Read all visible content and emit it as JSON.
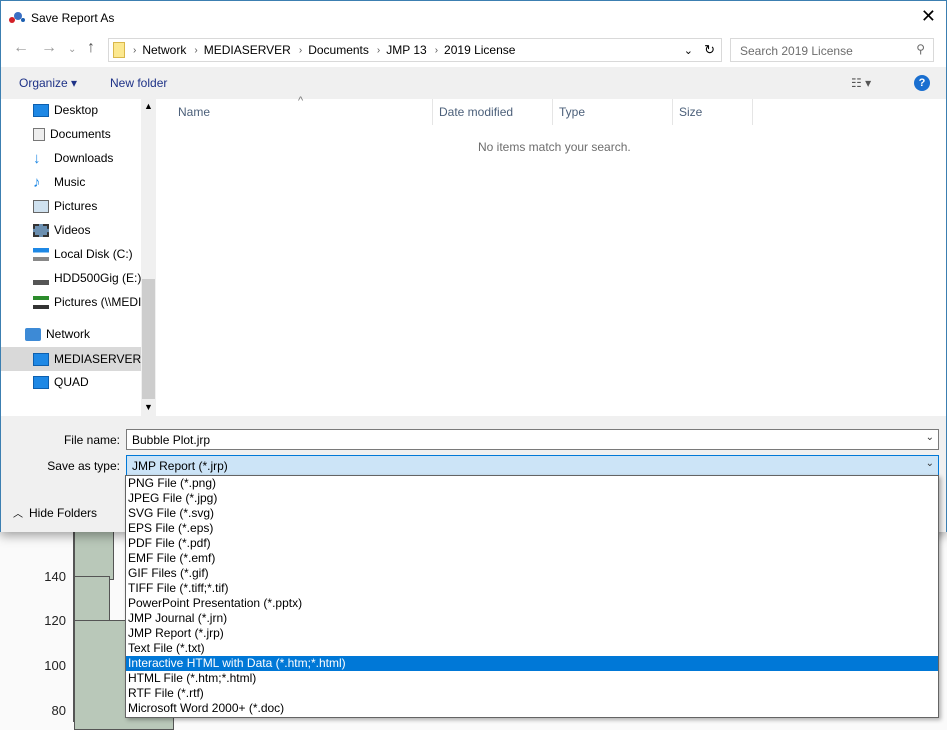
{
  "window": {
    "title": "Save Report As",
    "close": "✕"
  },
  "background_chart": {
    "y_ticks": [
      "140",
      "120",
      "100",
      "80"
    ]
  },
  "address": {
    "crumbs": [
      "Network",
      "MEDIASERVER",
      "Documents",
      "JMP 13",
      "2019 License"
    ]
  },
  "search": {
    "placeholder": "Search 2019 License"
  },
  "toolbar": {
    "organize": "Organize ▾",
    "new_folder": "New folder",
    "help": "?"
  },
  "sidebar": {
    "items": [
      {
        "label": "Desktop",
        "icon": "desktop-icon"
      },
      {
        "label": "Documents",
        "icon": "documents-icon"
      },
      {
        "label": "Downloads",
        "icon": "downloads-icon"
      },
      {
        "label": "Music",
        "icon": "music-icon"
      },
      {
        "label": "Pictures",
        "icon": "pictures-icon"
      },
      {
        "label": "Videos",
        "icon": "videos-icon"
      },
      {
        "label": "Local Disk (C:)",
        "icon": "disk-icon"
      },
      {
        "label": "HDD500Gig (E:)",
        "icon": "drive-icon"
      },
      {
        "label": "Pictures (\\\\MEDIASERVER)",
        "icon": "network-drive-icon"
      }
    ],
    "network": "Network",
    "computers": [
      "MEDIASERVER",
      "QUAD"
    ]
  },
  "list": {
    "columns": [
      "Name",
      "Date modified",
      "Type",
      "Size"
    ],
    "empty": "No items match your search."
  },
  "form": {
    "file_name_label": "File name:",
    "file_name": "Bubble Plot.jrp",
    "type_label": "Save as type:",
    "type_value": "JMP Report (*.jrp)",
    "hide_folders": "Hide Folders"
  },
  "types": [
    "PNG File (*.png)",
    "JPEG File (*.jpg)",
    "SVG File (*.svg)",
    "EPS File (*.eps)",
    "PDF File (*.pdf)",
    "EMF File (*.emf)",
    "GIF Files (*.gif)",
    "TIFF File (*.tiff;*.tif)",
    "PowerPoint Presentation (*.pptx)",
    "JMP Journal (*.jrn)",
    "JMP Report (*.jrp)",
    "Text File (*.txt)",
    "Interactive HTML with Data (*.htm;*.html)",
    "HTML File (*.htm;*.html)",
    "RTF File (*.rtf)",
    "Microsoft Word 2000+ (*.doc)"
  ],
  "selected_type_index": 12,
  "colors": {
    "accent": "#0078d7",
    "bar": "#b9c8b9"
  }
}
